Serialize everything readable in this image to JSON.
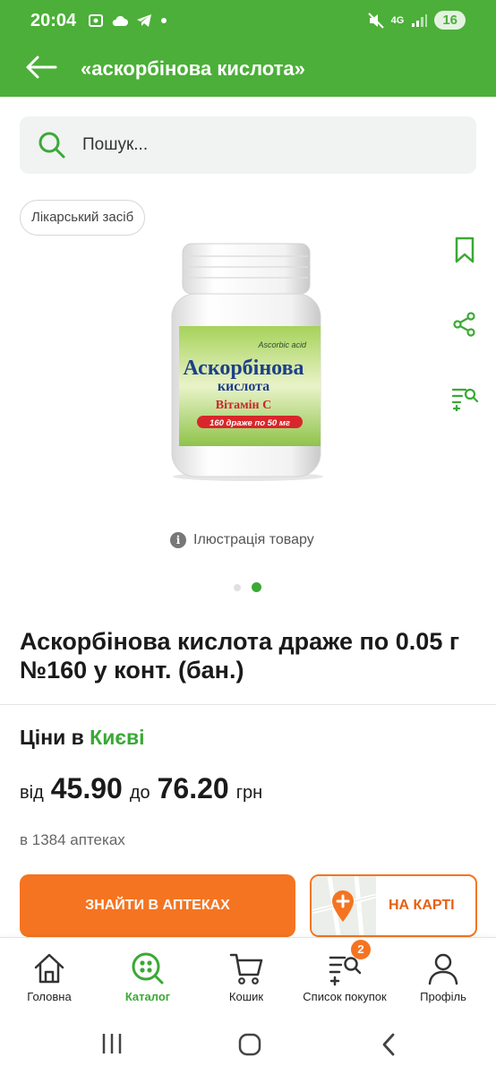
{
  "status_bar": {
    "time": "20:04",
    "network": "4G",
    "battery": "16"
  },
  "app_bar": {
    "title": "«аскорбінова кислота»"
  },
  "search": {
    "placeholder": "Пошук..."
  },
  "product": {
    "category_chip": "Лікарський засіб",
    "image_caption": "Ілюстрація товару",
    "package_label": {
      "latin": "Ascorbic acid",
      "name_line1": "Аскорбінова",
      "name_line2": "кислота",
      "vitamin": "Вітамін С",
      "dosage": "160 драже по 50 мг"
    },
    "carousel": {
      "total": 2,
      "active": 2
    },
    "title": "Аскорбінова кислота драже по 0.05 г №160 у конт. (бан.)"
  },
  "pricing": {
    "prices_in": "Ціни в",
    "city": "Києві",
    "from_label": "від",
    "price_min": "45.90",
    "to_label": "до",
    "price_max": "76.20",
    "currency": "грн",
    "pharmacies_count": "в 1384 аптеках"
  },
  "actions": {
    "find_button": "ЗНАЙТИ В АПТЕКАХ",
    "map_button": "НА КАРТІ"
  },
  "bottom_nav": {
    "items": [
      {
        "label": "Головна",
        "icon": "home-icon"
      },
      {
        "label": "Каталог",
        "icon": "catalog-icon"
      },
      {
        "label": "Кошик",
        "icon": "cart-icon"
      },
      {
        "label": "Список покупок",
        "icon": "shopping-list-icon",
        "badge": "2"
      },
      {
        "label": "Профіль",
        "icon": "profile-icon"
      }
    ],
    "active_index": 1
  },
  "colors": {
    "brand_green": "#4caf39",
    "accent_orange": "#f47421",
    "text_green": "#3aa935"
  }
}
